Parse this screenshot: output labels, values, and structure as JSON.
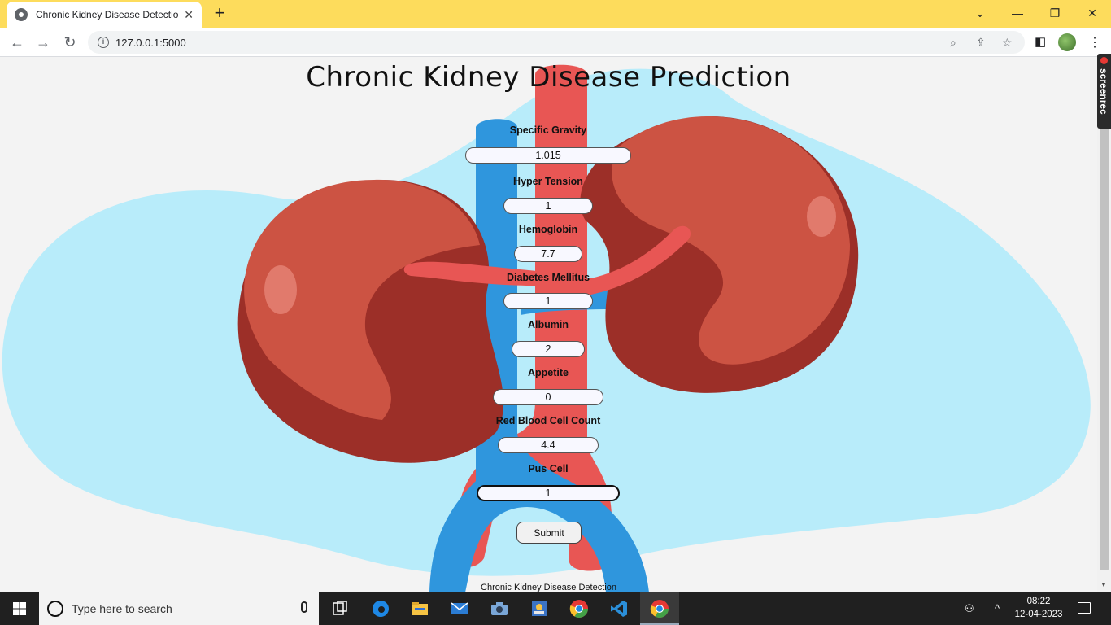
{
  "browser": {
    "tab_title": "Chronic Kidney Disease Detectior",
    "url": "127.0.0.1:5000"
  },
  "page": {
    "title": "Chronic Kidney Disease Prediction",
    "footer": "Chronic Kidney Disease Detection",
    "submit_label": "Submit",
    "fields": [
      {
        "label": "Specific Gravity",
        "value": "1.015"
      },
      {
        "label": "Hyper Tension",
        "value": "1"
      },
      {
        "label": "Hemoglobin",
        "value": "7.7"
      },
      {
        "label": "Diabetes Mellitus",
        "value": "1"
      },
      {
        "label": "Albumin",
        "value": "2"
      },
      {
        "label": "Appetite",
        "value": "0"
      },
      {
        "label": "Red Blood Cell Count",
        "value": "4.4"
      },
      {
        "label": "Pus Cell",
        "value": "1"
      }
    ]
  },
  "overlay": {
    "screenrec": "screenrec"
  },
  "taskbar": {
    "search_placeholder": "Type here to search",
    "time": "08:22",
    "date": "12-04-2023"
  },
  "colors": {
    "tab_strip": "#fddc5c",
    "blob": "#b8ecfa",
    "kidney": "#cc5343",
    "kidney_dark": "#9c2f28",
    "artery": "#e85654",
    "vein": "#2f96dd"
  }
}
